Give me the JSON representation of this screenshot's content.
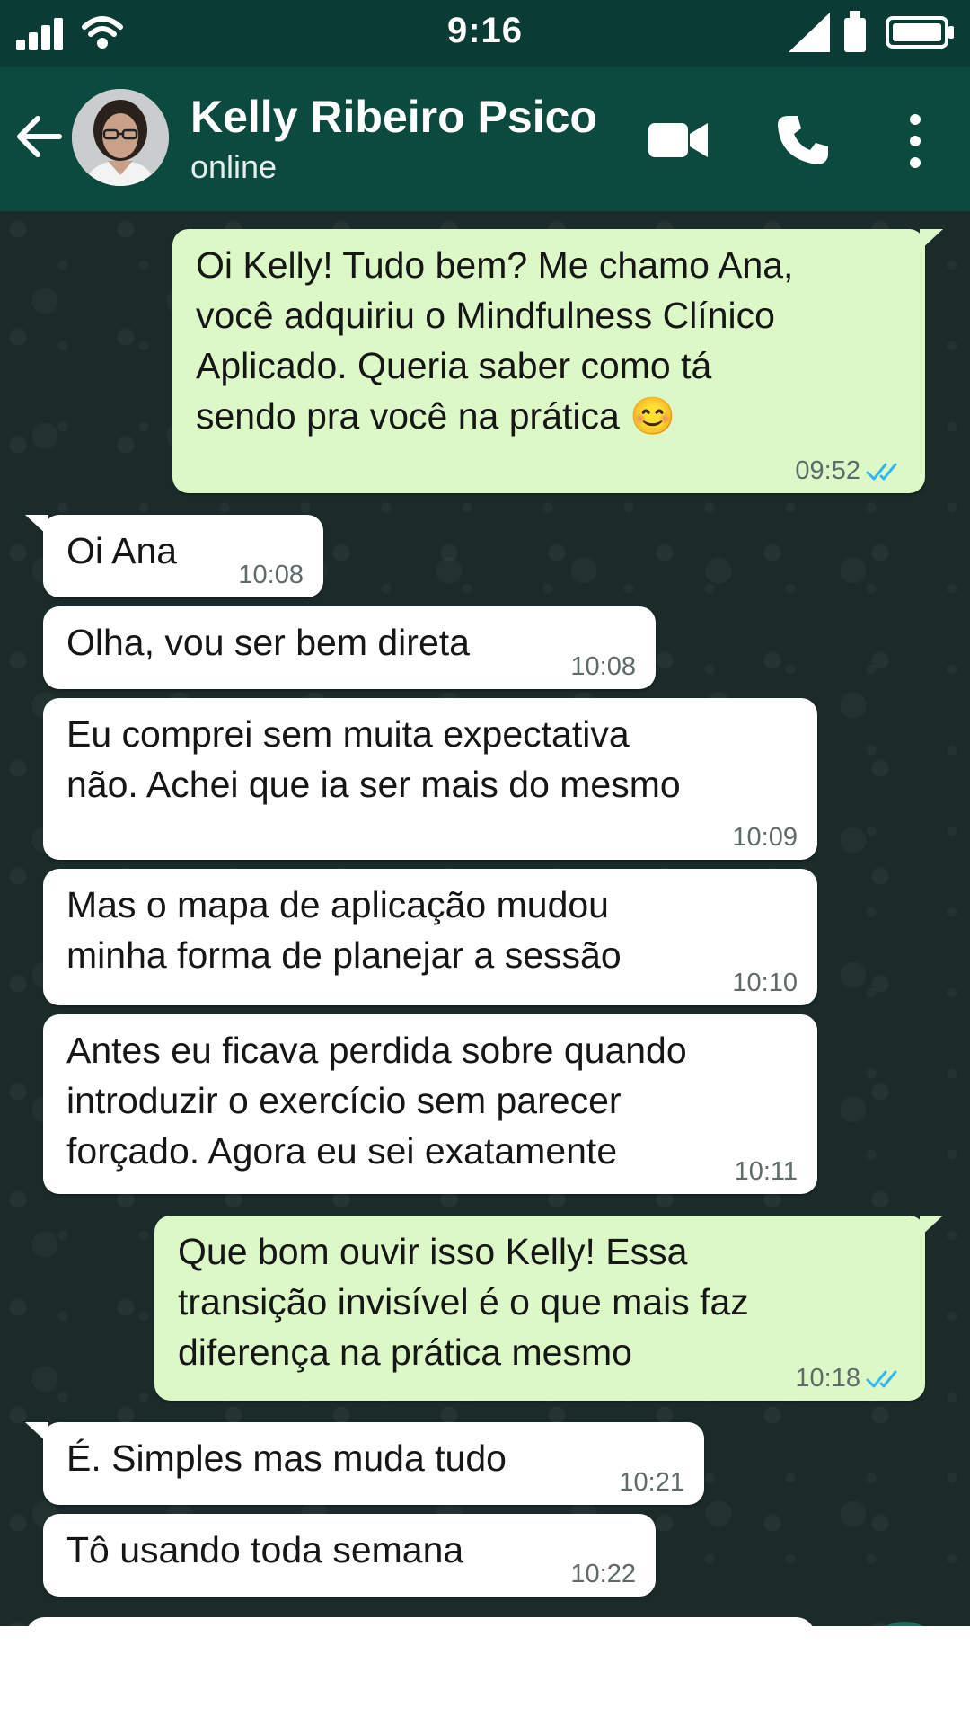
{
  "status_bar": {
    "time": "9:16"
  },
  "header": {
    "contact_name": "Kelly Ribeiro Psico",
    "contact_status": "online"
  },
  "colors": {
    "header_bg": "#0c4a40",
    "status_bg": "#0b3b35",
    "outgoing_bubble": "#dcf8c6",
    "incoming_bubble": "#ffffff",
    "chat_bg": "#1b2b2a",
    "read_ticks": "#34b7f1"
  },
  "icons": {
    "back": "arrow-left-icon",
    "video": "video-camera-icon",
    "call": "phone-icon",
    "menu": "more-vertical-icon",
    "read_receipt": "double-check-icon"
  },
  "messages": [
    {
      "direction": "out",
      "text": "Oi Kelly! Tudo bem? Me chamo Ana,\nvocê adquiriu o Mindfulness Clínico\nAplicado. Queria saber como tá\nsendo pra você na prática 😊",
      "time": "09:52",
      "read": true
    },
    {
      "direction": "in",
      "text": "Oi Ana",
      "time": "10:08"
    },
    {
      "direction": "in",
      "text": "Olha, vou ser bem direta",
      "time": "10:08"
    },
    {
      "direction": "in",
      "text": "Eu comprei sem muita expectativa\nnão. Achei que ia ser mais do mesmo",
      "time": "10:09"
    },
    {
      "direction": "in",
      "text": "Mas o mapa de aplicação mudou\nminha forma de planejar a sessão",
      "time": "10:10"
    },
    {
      "direction": "in",
      "text": "Antes eu ficava perdida sobre quando\nintroduzir o exercício sem parecer\nforçado. Agora eu sei exatamente",
      "time": "10:11"
    },
    {
      "direction": "out",
      "text": "Que bom ouvir isso Kelly! Essa\ntransição invisível é o que mais faz\ndiferença na prática mesmo",
      "time": "10:18",
      "read": true
    },
    {
      "direction": "in",
      "text": "É. Simples mas muda tudo",
      "time": "10:21"
    },
    {
      "direction": "in",
      "text": "Tô usando toda semana",
      "time": "10:22"
    }
  ]
}
